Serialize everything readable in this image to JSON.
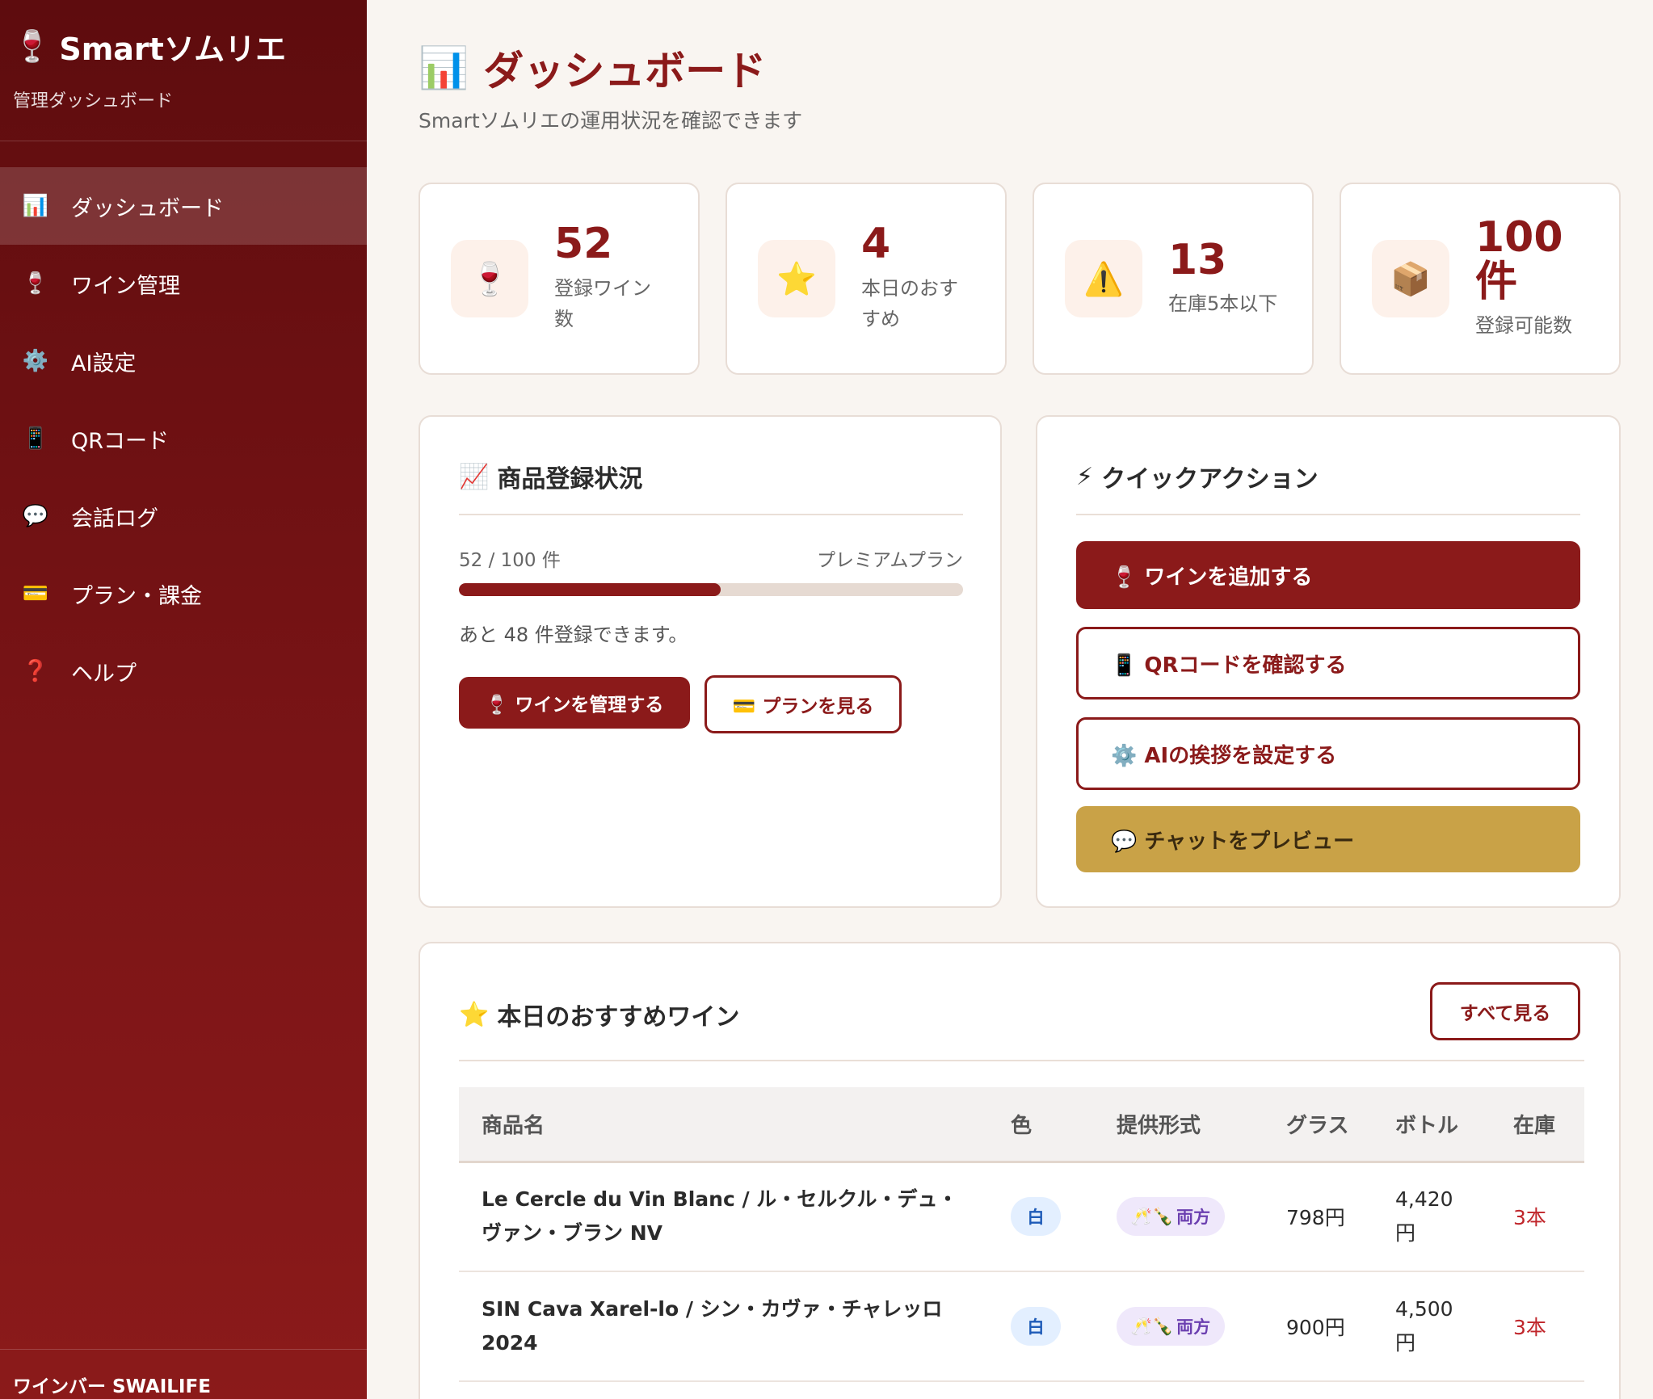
{
  "app": {
    "brand_icon": "🍷",
    "brand_name": "Smartソムリエ",
    "brand_sub": "管理ダッシュボード",
    "footer": "ワインバー SWAILIFE"
  },
  "nav": [
    {
      "icon": "📊",
      "label": "ダッシュボード",
      "active": true
    },
    {
      "icon": "🍷",
      "label": "ワイン管理"
    },
    {
      "icon": "⚙️",
      "label": "AI設定"
    },
    {
      "icon": "📱",
      "label": "QRコード"
    },
    {
      "icon": "💬",
      "label": "会話ログ"
    },
    {
      "icon": "💳",
      "label": "プラン・課金"
    },
    {
      "icon": "❓",
      "label": "ヘルプ"
    }
  ],
  "header": {
    "icon": "📊",
    "title": "ダッシュボード",
    "subtitle": "Smartソムリエの運用状況を確認できます"
  },
  "stats": [
    {
      "icon": "🍷",
      "value": "52",
      "label": "登録ワイン数"
    },
    {
      "icon": "⭐",
      "value": "4",
      "label": "本日のおすすめ"
    },
    {
      "icon": "⚠️",
      "value": "13",
      "label": "在庫5本以下"
    },
    {
      "icon": "📦",
      "value": "100件",
      "label": "登録可能数"
    }
  ],
  "registration": {
    "icon": "📈",
    "title": "商品登録状況",
    "count_text": "52 / 100 件",
    "plan": "プレミアムプラン",
    "progress": 0.52,
    "remaining": "あと 48 件登録できます。",
    "manage_button": "🍷 ワインを管理する",
    "plan_button": "💳 プランを見る"
  },
  "quick": {
    "icon": "⚡",
    "title": "クイックアクション",
    "add_wine": "🍷 ワインを追加する",
    "qr": "📱 QRコードを確認する",
    "ai": "⚙️ AIの挨拶を設定する",
    "preview": "💬 チャットをプレビュー"
  },
  "recommend": {
    "icon": "⭐",
    "title": "本日のおすすめワイン",
    "view_all": "すべて見る",
    "columns": [
      "商品名",
      "色",
      "提供形式",
      "グラス",
      "ボトル",
      "在庫"
    ],
    "rows": [
      {
        "name": "Le Cercle du Vin Blanc / ル・セルクル・デュ・ヴァン・ブラン NV",
        "color": "白",
        "format_icon": "🥂🍾",
        "format": "両方",
        "glass": "798円",
        "bottle": "4,420円",
        "stock": "3本"
      },
      {
        "name": "SIN Cava Xarel-lo / シン・カヴァ・チャレッロ 2024",
        "color": "白",
        "format_icon": "🥂🍾",
        "format": "両方",
        "glass": "900円",
        "bottle": "4,500円",
        "stock": "3本"
      }
    ]
  },
  "colors": {
    "brand": "#8b1a1a",
    "gold": "#c9a247",
    "background": "#f9f5f1"
  }
}
